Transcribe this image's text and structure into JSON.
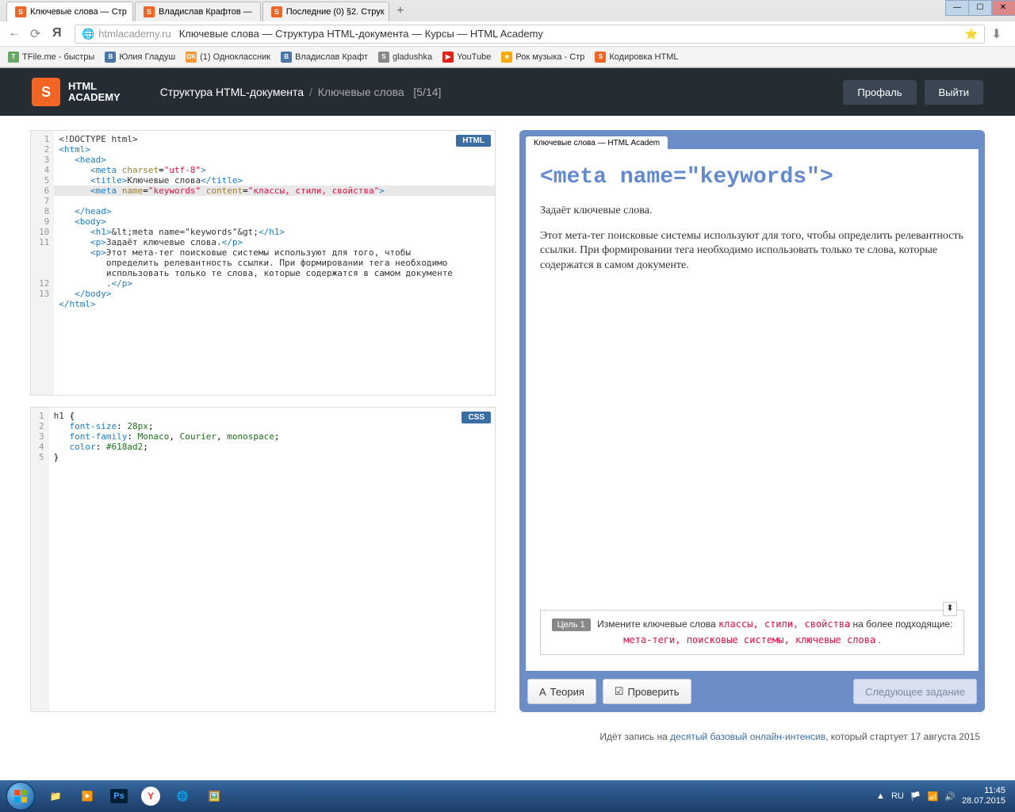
{
  "browser": {
    "tabs": [
      {
        "label": "Ключевые слова — Стр",
        "active": true
      },
      {
        "label": "Владислав Крафтов —",
        "active": false
      },
      {
        "label": "Последние (0) §2. Струк",
        "active": false
      }
    ],
    "url_host": "htmlacademy.ru",
    "url_title": "Ключевые слова — Структура HTML-документа — Курсы — HTML Academy",
    "bookmarks": [
      {
        "label": "TFile.me - быстры",
        "color": "#6a6"
      },
      {
        "label": "Юлия Гладуш",
        "color": "#4a76a8"
      },
      {
        "label": "(1) Одноклассник",
        "color": "#f93"
      },
      {
        "label": "Владислав Крафт",
        "color": "#4a76a8"
      },
      {
        "label": "gladushka",
        "color": "#888"
      },
      {
        "label": "YouTube",
        "color": "#e62117"
      },
      {
        "label": "Рок музыка - Стр",
        "color": "#fa0"
      },
      {
        "label": "Кодировка HTML",
        "color": "#f26522"
      }
    ]
  },
  "header": {
    "logo_top": "HTML",
    "logo_bottom": "ACADEMY",
    "crumb_main": "Структура HTML-документа",
    "crumb_sub": "Ключевые слова",
    "counter": "[5/14]",
    "profile": "Профаль",
    "logout": "Выйти"
  },
  "editors": {
    "html_badge": "HTML",
    "css_badge": "CSS",
    "css_code": "h1 {\n   font-size: 28px;\n   font-family: Monaco, Courier, monospace;\n   color: #618ad2;\n}"
  },
  "preview": {
    "tab_label": "Ключевые слова — HTML Academ",
    "h1": "<meta name=\"keywords\">",
    "p1": "Задаёт ключевые слова.",
    "p2": "Этот мета-тег поисковые системы используют для того, чтобы определить релевантность ссылки. При формировании тега необходимо использовать только те слова, которые содержатся в самом документе.",
    "goal_label": "Цель 1",
    "goal_text_1": "Измените ключевые слова",
    "goal_code_1": "классы, стили, свойства",
    "goal_text_2": "на более подходящие:",
    "goal_code_2": "мета-теги, поисковые системы, ключевые слова",
    "btn_theory": "Теория",
    "btn_check": "Проверить",
    "btn_next": "Следующее задание"
  },
  "promo": {
    "pre": "Идёт запись на ",
    "link": "десятый базовый онлайн-интенсив",
    "post": ", который стартует 17 августа 2015"
  },
  "taskbar": {
    "lang": "RU",
    "time": "11:45",
    "date": "28.07.2015"
  }
}
